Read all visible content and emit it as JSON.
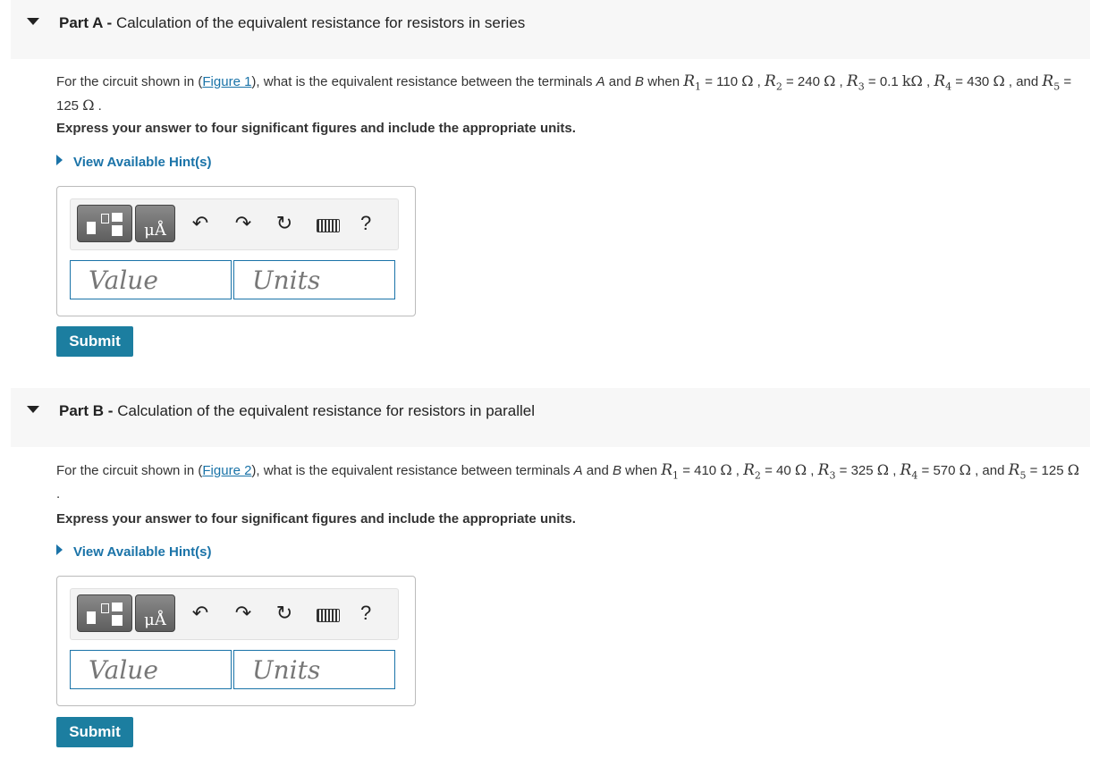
{
  "parts": [
    {
      "label": "Part A -",
      "title": "Calculation of the equivalent resistance for resistors in series",
      "q_pre": "For the circuit shown in (",
      "fig_link": "Figure 1",
      "q_mid": "), what is the equivalent resistance between the terminals ",
      "term_a": "A",
      "and_word": " and ",
      "term_b": "B",
      "when": " when ",
      "resistors": [
        {
          "sym": "R",
          "sub": "1",
          "eq": " = 110 ",
          "unit": "Ω",
          "sep": " , "
        },
        {
          "sym": "R",
          "sub": "2",
          "eq": " = 240 ",
          "unit": "Ω",
          "sep": " , "
        },
        {
          "sym": "R",
          "sub": "3",
          "eq": " = 0.1 ",
          "unit": "kΩ",
          "sep": " , "
        },
        {
          "sym": "R",
          "sub": "4",
          "eq": " = 430 ",
          "unit": "Ω",
          "sep": " , and "
        },
        {
          "sym": "R",
          "sub": "5",
          "eq": " = 125 ",
          "unit": "Ω",
          "sep": " ."
        }
      ],
      "instruction": "Express your answer to four significant figures and include the appropriate units.",
      "hint": "View Available Hint(s)",
      "units_glyph": "μÅ",
      "undo": "↶",
      "redo": "↷",
      "reset": "↻",
      "help": "?",
      "value_placeholder": "Value",
      "units_placeholder": "Units",
      "submit": "Submit"
    },
    {
      "label": "Part B -",
      "title": "Calculation of the equivalent resistance for resistors in parallel",
      "q_pre": "For the circuit shown in (",
      "fig_link": "Figure 2",
      "q_mid": "), what is the equivalent resistance between terminals ",
      "term_a": "A",
      "and_word": " and ",
      "term_b": "B",
      "when": " when ",
      "resistors": [
        {
          "sym": "R",
          "sub": "1",
          "eq": " = 410 ",
          "unit": "Ω",
          "sep": " , "
        },
        {
          "sym": "R",
          "sub": "2",
          "eq": " = 40 ",
          "unit": "Ω",
          "sep": " , "
        },
        {
          "sym": "R",
          "sub": "3",
          "eq": " = 325 ",
          "unit": "Ω",
          "sep": " , "
        },
        {
          "sym": "R",
          "sub": "4",
          "eq": " = 570 ",
          "unit": "Ω",
          "sep": " , and "
        },
        {
          "sym": "R",
          "sub": "5",
          "eq": " = 125 ",
          "unit": "Ω",
          "sep": " ."
        }
      ],
      "instruction": "Express your answer to four significant figures and include the appropriate units.",
      "hint": "View Available Hint(s)",
      "units_glyph": "μÅ",
      "undo": "↶",
      "redo": "↷",
      "reset": "↻",
      "help": "?",
      "value_placeholder": "Value",
      "units_placeholder": "Units",
      "submit": "Submit"
    }
  ]
}
